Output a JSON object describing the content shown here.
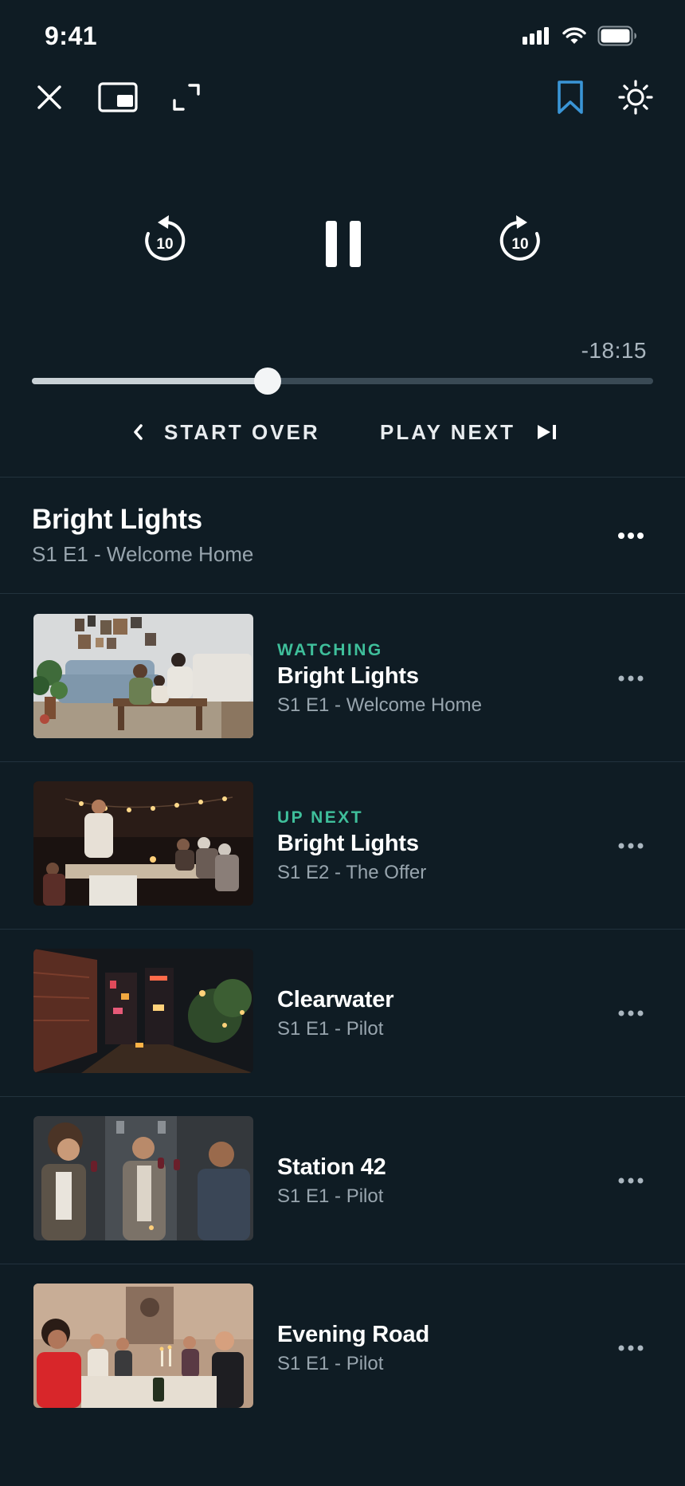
{
  "status_bar": {
    "time": "9:41"
  },
  "toolbar": {
    "close_icon": "close-icon",
    "pip_icon": "picture-in-picture-icon",
    "fullscreen_icon": "expand-icon",
    "bookmark_icon": "bookmark-icon",
    "settings_icon": "brightness-icon"
  },
  "playback": {
    "rewind_seconds": "10",
    "forward_seconds": "10",
    "time_remaining": "-18:15",
    "progress_fraction": 0.38,
    "start_over_label": "START OVER",
    "play_next_label": "PLAY NEXT"
  },
  "now_playing": {
    "title": "Bright Lights",
    "subtitle": "S1 E1 - Welcome Home"
  },
  "episodes": [
    {
      "status": "WATCHING",
      "title": "Bright Lights",
      "subtitle": "S1 E1 - Welcome Home"
    },
    {
      "status": "UP NEXT",
      "title": "Bright Lights",
      "subtitle": "S1 E2 - The Offer"
    },
    {
      "status": "",
      "title": "Clearwater",
      "subtitle": "S1 E1 - Pilot"
    },
    {
      "status": "",
      "title": "Station 42",
      "subtitle": "S1 E1 - Pilot"
    },
    {
      "status": "",
      "title": "Evening Road",
      "subtitle": "S1 E1 - Pilot"
    }
  ],
  "colors": {
    "background": "#0f1c24",
    "accent_status": "#3fbf9b",
    "bookmark": "#3a95d6"
  }
}
